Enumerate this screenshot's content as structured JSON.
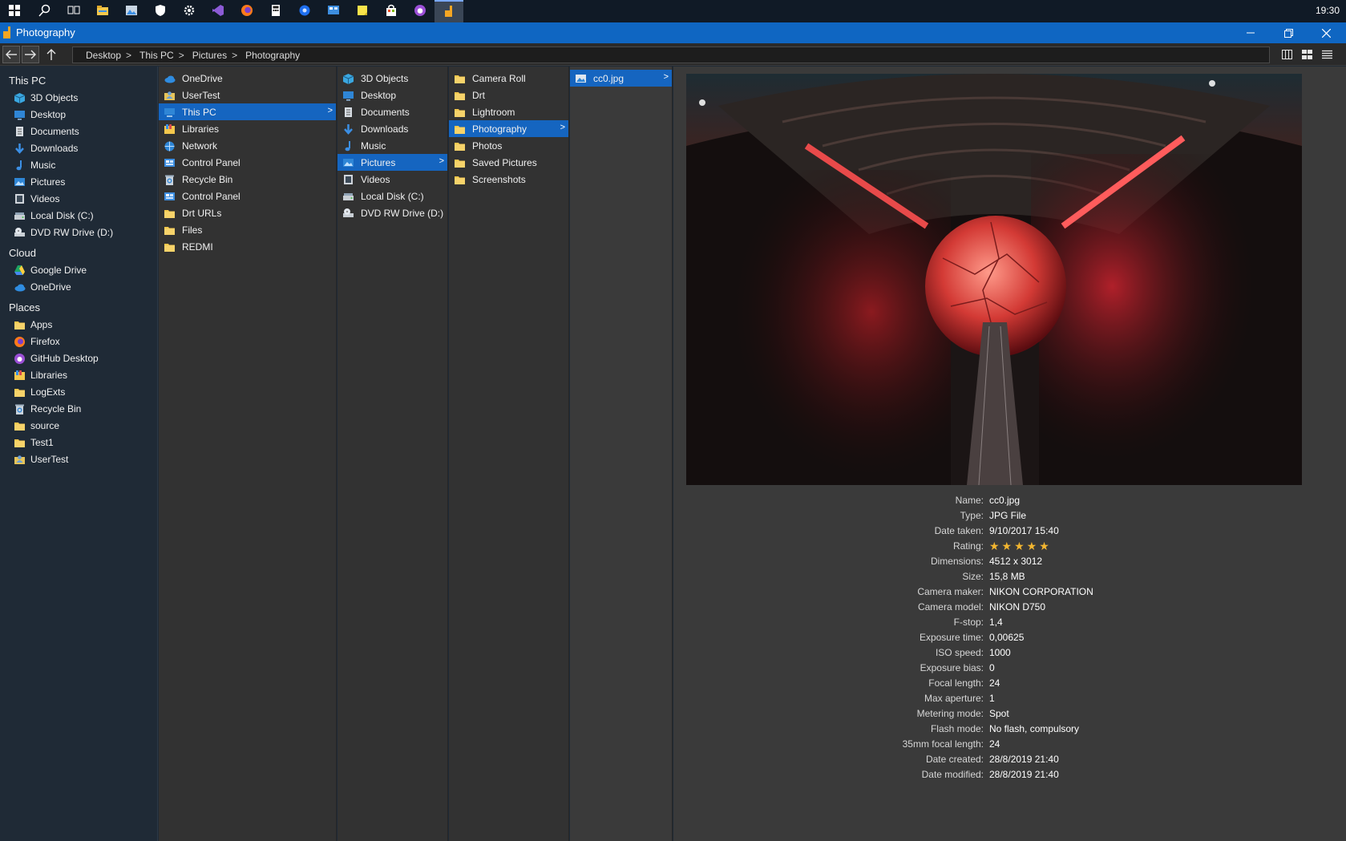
{
  "taskbar": {
    "clock": "19:30",
    "icons": [
      "windows-start-icon",
      "search-icon",
      "task-view-icon",
      "file-explorer-icon",
      "photos-icon",
      "shield-icon",
      "settings-gear-icon",
      "visual-studio-icon",
      "firefox-icon",
      "calculator-icon",
      "blue-circle-app-icon",
      "control-panel-icon",
      "sticky-notes-icon",
      "store-icon",
      "github-desktop-icon",
      "files-app-icon"
    ]
  },
  "window": {
    "title": "Photography"
  },
  "breadcrumb": [
    "Desktop",
    "This PC",
    "Pictures",
    "Photography"
  ],
  "sidebar": {
    "sections": [
      {
        "heading": "This PC",
        "items": [
          {
            "label": "3D Objects",
            "icon": "3d-objects-icon"
          },
          {
            "label": "Desktop",
            "icon": "desktop-icon"
          },
          {
            "label": "Documents",
            "icon": "documents-icon"
          },
          {
            "label": "Downloads",
            "icon": "downloads-icon"
          },
          {
            "label": "Music",
            "icon": "music-icon"
          },
          {
            "label": "Pictures",
            "icon": "pictures-icon"
          },
          {
            "label": "Videos",
            "icon": "videos-icon"
          },
          {
            "label": "Local Disk (C:)",
            "icon": "local-disk-icon"
          },
          {
            "label": "DVD RW Drive (D:)",
            "icon": "dvd-drive-icon"
          }
        ]
      },
      {
        "heading": "Cloud",
        "items": [
          {
            "label": "Google Drive",
            "icon": "google-drive-icon"
          },
          {
            "label": "OneDrive",
            "icon": "onedrive-icon"
          }
        ]
      },
      {
        "heading": "Places",
        "items": [
          {
            "label": "Apps",
            "icon": "folder-icon"
          },
          {
            "label": "Firefox",
            "icon": "firefox-icon"
          },
          {
            "label": "GitHub Desktop",
            "icon": "github-desktop-icon"
          },
          {
            "label": "Libraries",
            "icon": "libraries-icon"
          },
          {
            "label": "LogExts",
            "icon": "folder-icon"
          },
          {
            "label": "Recycle Bin",
            "icon": "recycle-bin-icon"
          },
          {
            "label": "source",
            "icon": "folder-icon"
          },
          {
            "label": "Test1",
            "icon": "folder-icon"
          },
          {
            "label": "UserTest",
            "icon": "user-folder-icon"
          }
        ]
      }
    ]
  },
  "columns": [
    [
      {
        "label": "OneDrive",
        "icon": "onedrive-icon"
      },
      {
        "label": "UserTest",
        "icon": "user-folder-icon"
      },
      {
        "label": "This PC",
        "icon": "this-pc-icon",
        "selected": true
      },
      {
        "label": "Libraries",
        "icon": "libraries-icon"
      },
      {
        "label": "Network",
        "icon": "network-icon"
      },
      {
        "label": "Control Panel",
        "icon": "control-panel-icon"
      },
      {
        "label": "Recycle Bin",
        "icon": "recycle-bin-icon"
      },
      {
        "label": "Control Panel",
        "icon": "control-panel-icon"
      },
      {
        "label": "Drt URLs",
        "icon": "folder-icon"
      },
      {
        "label": "Files",
        "icon": "folder-icon"
      },
      {
        "label": "REDMI",
        "icon": "folder-icon"
      }
    ],
    [
      {
        "label": "3D Objects",
        "icon": "3d-objects-icon"
      },
      {
        "label": "Desktop",
        "icon": "desktop-icon"
      },
      {
        "label": "Documents",
        "icon": "documents-icon"
      },
      {
        "label": "Downloads",
        "icon": "downloads-icon"
      },
      {
        "label": "Music",
        "icon": "music-icon"
      },
      {
        "label": "Pictures",
        "icon": "pictures-icon",
        "selected": true
      },
      {
        "label": "Videos",
        "icon": "videos-icon"
      },
      {
        "label": "Local Disk (C:)",
        "icon": "local-disk-icon"
      },
      {
        "label": "DVD RW Drive (D:)",
        "icon": "dvd-drive-icon"
      }
    ],
    [
      {
        "label": "Camera Roll",
        "icon": "folder-icon"
      },
      {
        "label": "Drt",
        "icon": "folder-icon"
      },
      {
        "label": "Lightroom",
        "icon": "folder-icon"
      },
      {
        "label": "Photography",
        "icon": "folder-icon",
        "selected": true
      },
      {
        "label": "Photos",
        "icon": "folder-icon"
      },
      {
        "label": "Saved Pictures",
        "icon": "folder-icon"
      },
      {
        "label": "Screenshots",
        "icon": "folder-icon"
      }
    ],
    [
      {
        "label": "cc0.jpg",
        "icon": "image-file-icon",
        "selected": true
      }
    ]
  ],
  "preview": {
    "rating": 5,
    "rating_max": 5,
    "properties": [
      {
        "label": "Name:",
        "value": "cc0.jpg"
      },
      {
        "label": "Type:",
        "value": "JPG File"
      },
      {
        "label": "Date taken:",
        "value": "9/10/2017 15:40"
      },
      {
        "label": "Rating:",
        "value": "★★★★★"
      },
      {
        "label": "Dimensions:",
        "value": "4512 x 3012"
      },
      {
        "label": "Size:",
        "value": "15,8 MB"
      },
      {
        "label": "Camera maker:",
        "value": "NIKON CORPORATION"
      },
      {
        "label": "Camera model:",
        "value": "NIKON D750"
      },
      {
        "label": "F-stop:",
        "value": "1,4"
      },
      {
        "label": "Exposure time:",
        "value": "0,00625"
      },
      {
        "label": "ISO speed:",
        "value": "1000"
      },
      {
        "label": "Exposure bias:",
        "value": "0"
      },
      {
        "label": "Focal length:",
        "value": "24"
      },
      {
        "label": "Max aperture:",
        "value": "1"
      },
      {
        "label": "Metering mode:",
        "value": "Spot"
      },
      {
        "label": "Flash mode:",
        "value": "No flash, compulsory"
      },
      {
        "label": "35mm focal length:",
        "value": "24"
      },
      {
        "label": "Date created:",
        "value": "28/8/2019 21:40"
      },
      {
        "label": "Date modified:",
        "value": "28/8/2019 21:40"
      }
    ]
  },
  "colors": {
    "accent": "#1565c0",
    "titlebar": "#0f66c2",
    "star": "#f3b630",
    "folder": "#f5c84c"
  }
}
